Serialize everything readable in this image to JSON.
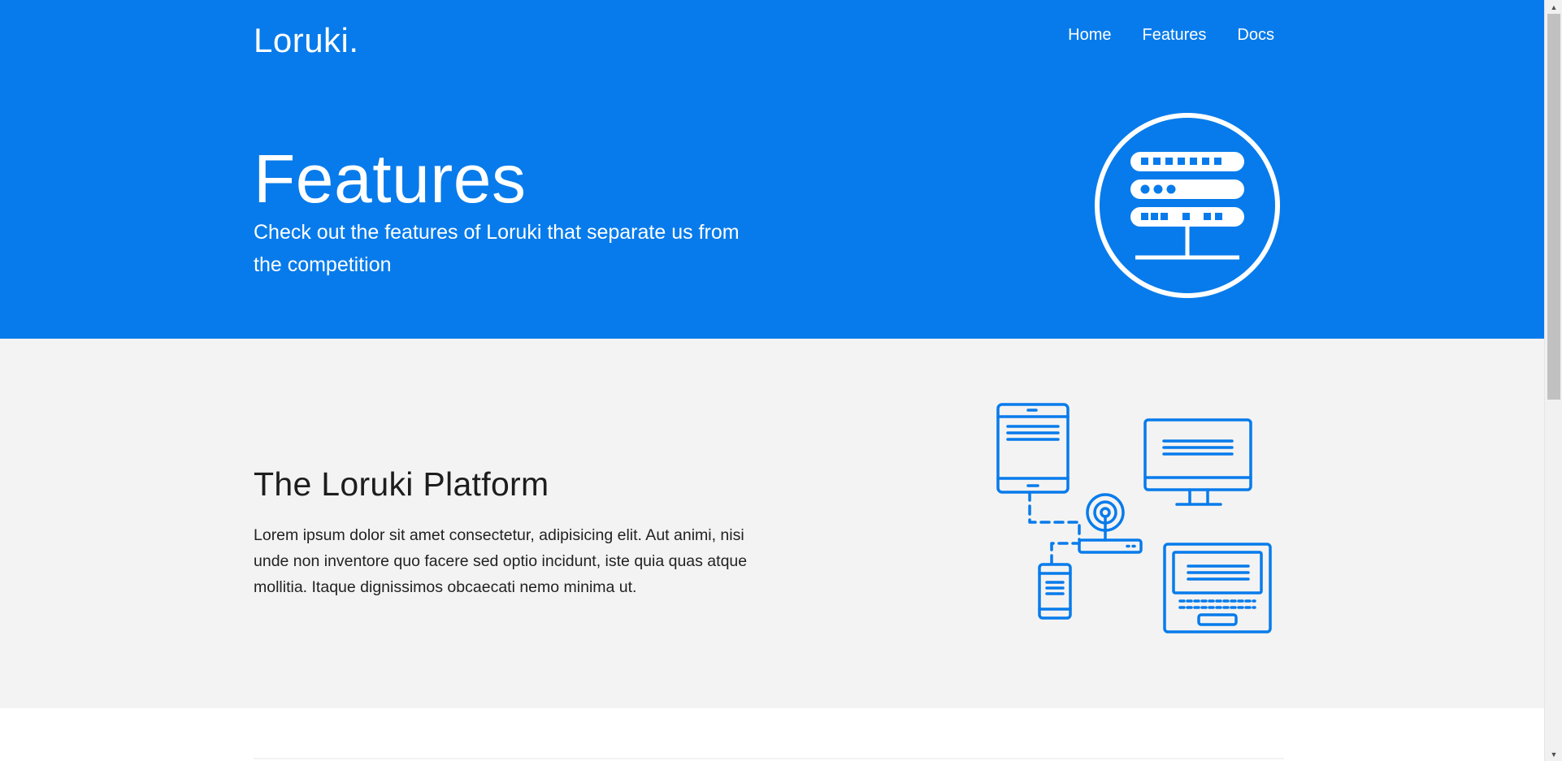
{
  "brand": {
    "logo": "Loruki."
  },
  "nav": {
    "items": [
      {
        "label": "Home"
      },
      {
        "label": "Features"
      },
      {
        "label": "Docs"
      }
    ]
  },
  "hero": {
    "title": "Features",
    "subtitle": "Check out the features of Loruki that separate us from the competition",
    "icon": "server-icon"
  },
  "platform": {
    "title": "The Loruki Platform",
    "body": "Lorem ipsum dolor sit amet consectetur, adipisicing elit. Aut animi, nisi unde non inventore quo facere sed optio incidunt, iste quia quas atque mollitia. Itaque dignissimos obcaecati nemo minima ut.",
    "icon": "network-devices-icon"
  },
  "colors": {
    "primary": "#077beb",
    "light_bg": "#f3f3f3",
    "text": "#222222"
  }
}
